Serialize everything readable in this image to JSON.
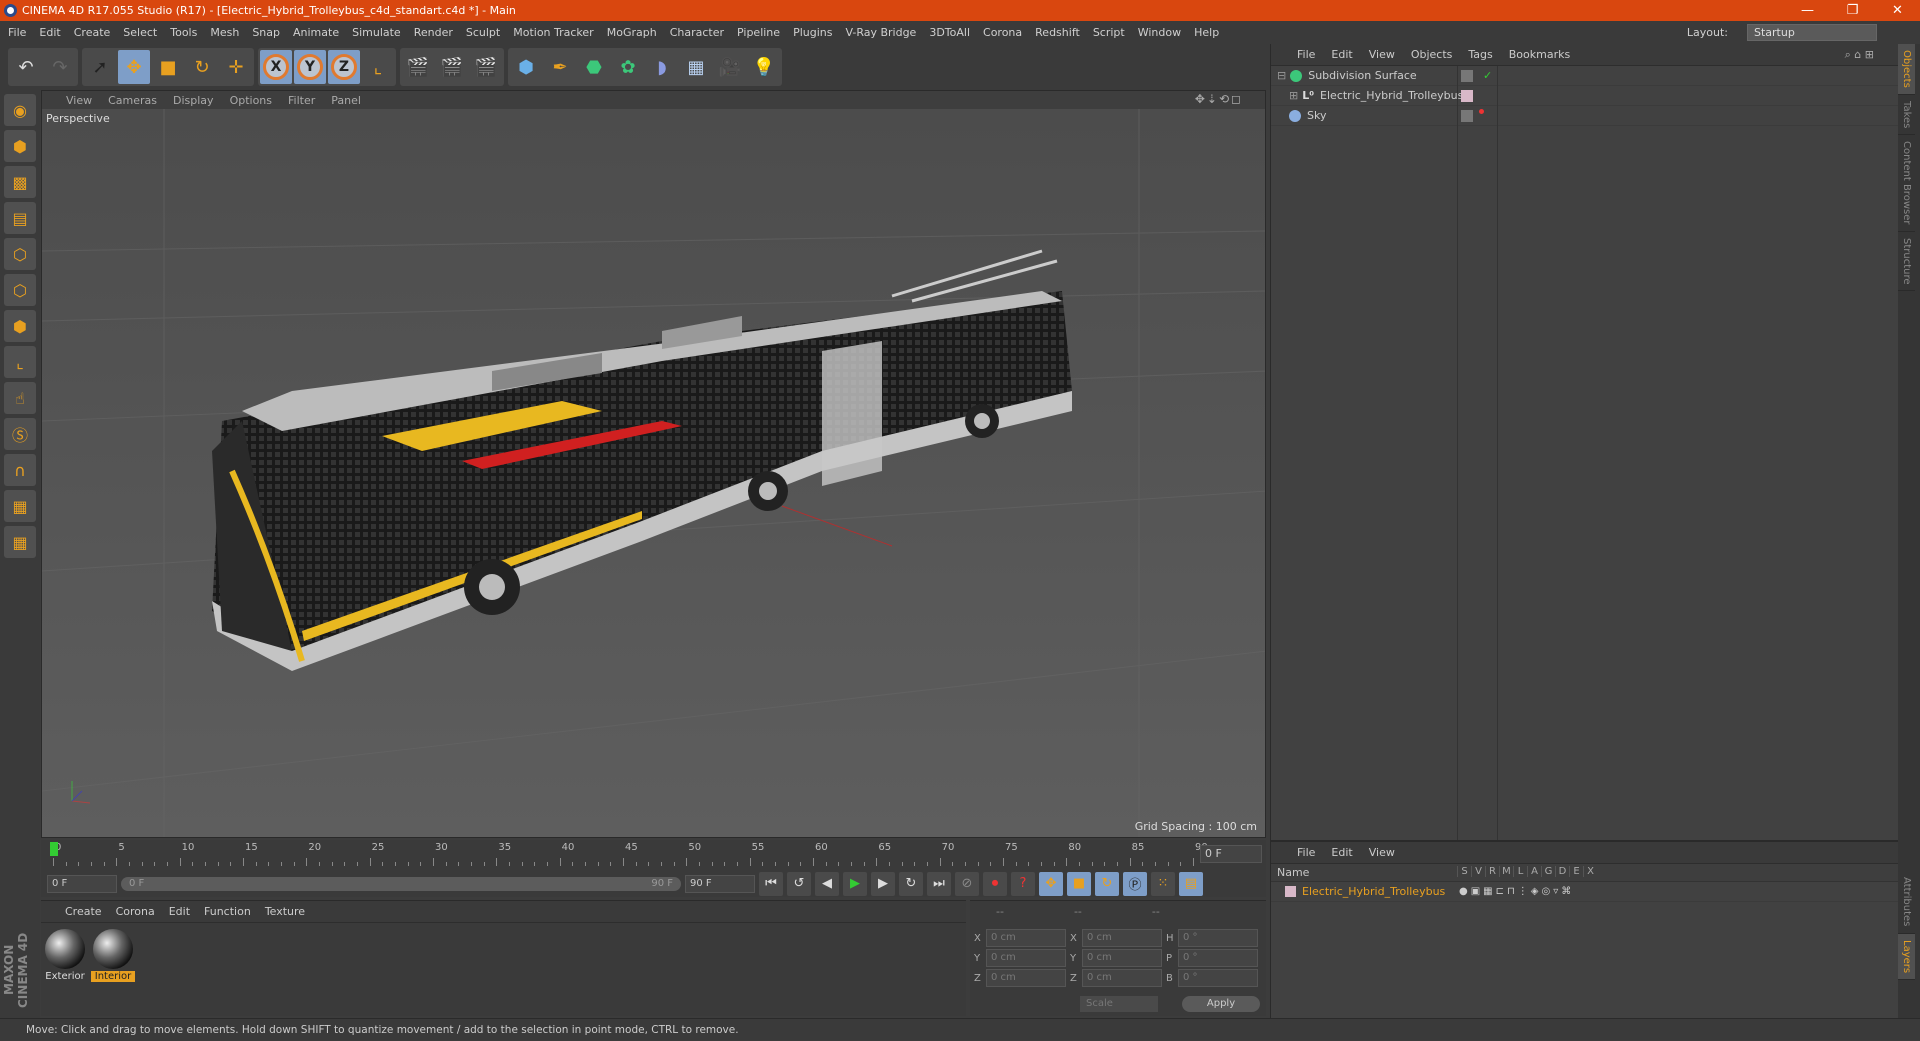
{
  "window": {
    "title": "CINEMA 4D R17.055 Studio (R17) - [Electric_Hybrid_Trolleybus_c4d_standart.c4d *] - Main",
    "controls": [
      "—",
      "❐",
      "✕"
    ]
  },
  "menubar": {
    "items": [
      "File",
      "Edit",
      "Create",
      "Select",
      "Tools",
      "Mesh",
      "Snap",
      "Animate",
      "Simulate",
      "Render",
      "Sculpt",
      "Motion Tracker",
      "MoGraph",
      "Character",
      "Pipeline",
      "Plugins",
      "V-Ray Bridge",
      "3DToAll",
      "Corona",
      "Redshift",
      "Script",
      "Window",
      "Help"
    ],
    "layout_label": "Layout:",
    "layout_value": "Startup"
  },
  "toolbar": {
    "icons": [
      "undo-icon",
      "redo-icon",
      "select-icon",
      "move-icon",
      "scale-icon",
      "rotate-icon",
      "transform-icon",
      "x-axis-icon",
      "y-axis-icon",
      "z-axis-icon",
      "coordinate-system-icon",
      "render-view-icon",
      "render-picture-viewer-icon",
      "render-settings-icon",
      "cube-icon",
      "pen-icon",
      "subdivision-icon",
      "mograph-icon",
      "deformer-icon",
      "floor-icon",
      "camera-icon",
      "light-icon"
    ],
    "axes": [
      "X",
      "Y",
      "Z"
    ]
  },
  "viewport": {
    "menu": [
      "View",
      "Cameras",
      "Display",
      "Options",
      "Filter",
      "Panel"
    ],
    "camera": "Perspective",
    "grid_spacing": "Grid Spacing : 100 cm"
  },
  "timeline": {
    "ticks": [
      "0",
      "5",
      "10",
      "15",
      "20",
      "25",
      "30",
      "35",
      "40",
      "45",
      "50",
      "55",
      "60",
      "65",
      "70",
      "75",
      "80",
      "85",
      "90"
    ],
    "current_frame": "0 F",
    "start": "0 F",
    "range_start": "0 F",
    "range_end": "90 F",
    "end": "90 F"
  },
  "materials": {
    "menu": [
      "Create",
      "Corona",
      "Edit",
      "Function",
      "Texture"
    ],
    "items": [
      {
        "name": "Exterior",
        "selected": false
      },
      {
        "name": "Interior",
        "selected": true
      }
    ]
  },
  "coordinates": {
    "headers": [
      "--",
      "--",
      "--"
    ],
    "rows": [
      {
        "a": "X",
        "v1": "0 cm",
        "b": "X",
        "v2": "0 cm",
        "c": "H",
        "v3": "0 °"
      },
      {
        "a": "Y",
        "v1": "0 cm",
        "b": "Y",
        "v2": "0 cm",
        "c": "P",
        "v3": "0 °"
      },
      {
        "a": "Z",
        "v1": "0 cm",
        "b": "Z",
        "v2": "0 cm",
        "c": "B",
        "v3": "0 °"
      }
    ],
    "mode": "Scale",
    "apply": "Apply"
  },
  "objects": {
    "menu": [
      "File",
      "Edit",
      "View",
      "Objects",
      "Tags",
      "Bookmarks"
    ],
    "items": [
      {
        "name": "Subdivision Surface",
        "icon_color": "#3cc87a",
        "check": "✓"
      },
      {
        "name": "Electric_Hybrid_Trolleybus",
        "icon_color": "#e8e8e8"
      },
      {
        "name": "Sky",
        "icon_color": "#8aaee0"
      }
    ]
  },
  "layers": {
    "menu": [
      "File",
      "Edit",
      "View"
    ],
    "name_header": "Name",
    "columns": [
      "S",
      "V",
      "R",
      "M",
      "L",
      "A",
      "G",
      "D",
      "E",
      "X"
    ],
    "items": [
      {
        "name": "Electric_Hybrid_Trolleybus",
        "color": "#d8b8c8"
      }
    ]
  },
  "side_tabs": {
    "top": [
      "Objects",
      "Takes",
      "Content Browser",
      "Structure"
    ],
    "bottom": [
      "Attributes",
      "Layers"
    ]
  },
  "status": "Move: Click and drag to move elements. Hold down SHIFT to quantize movement / add to the selection in point mode, CTRL to remove.",
  "branding": "MAXON CINEMA 4D",
  "colors": {
    "titlebar": "#d9470f",
    "accent": "#e8a020",
    "selection": "#7e9ec8"
  }
}
